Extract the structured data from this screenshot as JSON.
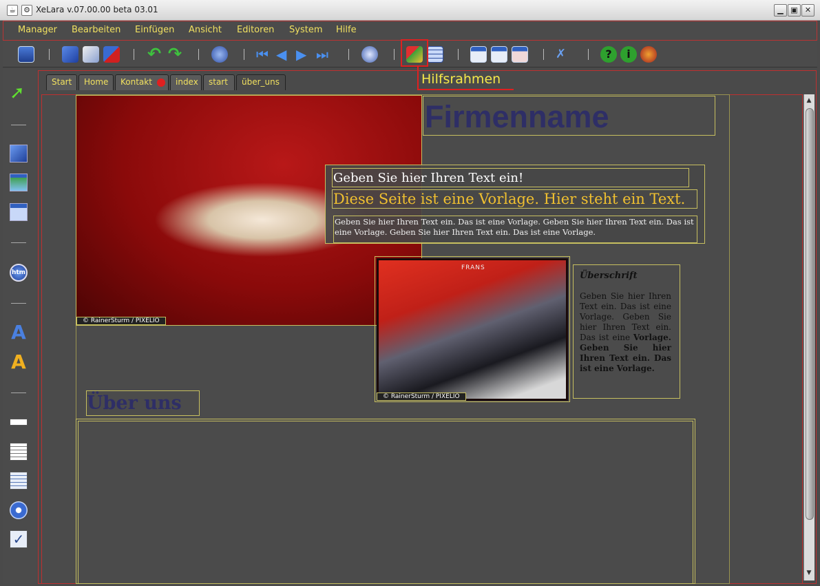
{
  "window": {
    "title": "XeLara v.07.00.00 beta 03.01"
  },
  "menu": [
    "Manager",
    "Bearbeiten",
    "Einfügen",
    "Ansicht",
    "Editoren",
    "System",
    "Hilfe"
  ],
  "callout": {
    "label": "Hilfsrahmen"
  },
  "tabs": [
    "Start",
    "Home",
    "Kontakt",
    "index",
    "start",
    "über_uns"
  ],
  "content": {
    "company": "Firmenname",
    "heading_box": "Geben Sie hier Ihren Text ein!",
    "subheading": "Diese Seite ist eine Vorlage. Hier steht ein Text.",
    "paragraph": "Geben Sie hier Ihren Text ein. Das ist eine Vorlage.  Geben Sie hier Ihren Text ein. Das ist eine Vorlage. Geben Sie hier Ihren Text ein. Das ist eine Vorlage.",
    "side_title": "Überschrift",
    "side_text_a": "Geben Sie hier Ihren Text ein. Das ist eine Vorlage.  Geben Sie hier Ihren Text ein. Das ist eine",
    "side_text_b": "Vorlage. Geben Sie hier Ihren Text ein. Das ist eine Vorlage.",
    "section_title": "Über uns",
    "photo_credit_1": "© RainerSturm / PIXELIO",
    "photo_credit_2": "© RainerSturm / PIXELIO",
    "escalator_sign": "FRANS"
  },
  "colors": {
    "menu_text": "#f0e060",
    "accent_red": "#e02020",
    "frame": "#c8c060",
    "heading_blue": "#2e2e66"
  }
}
